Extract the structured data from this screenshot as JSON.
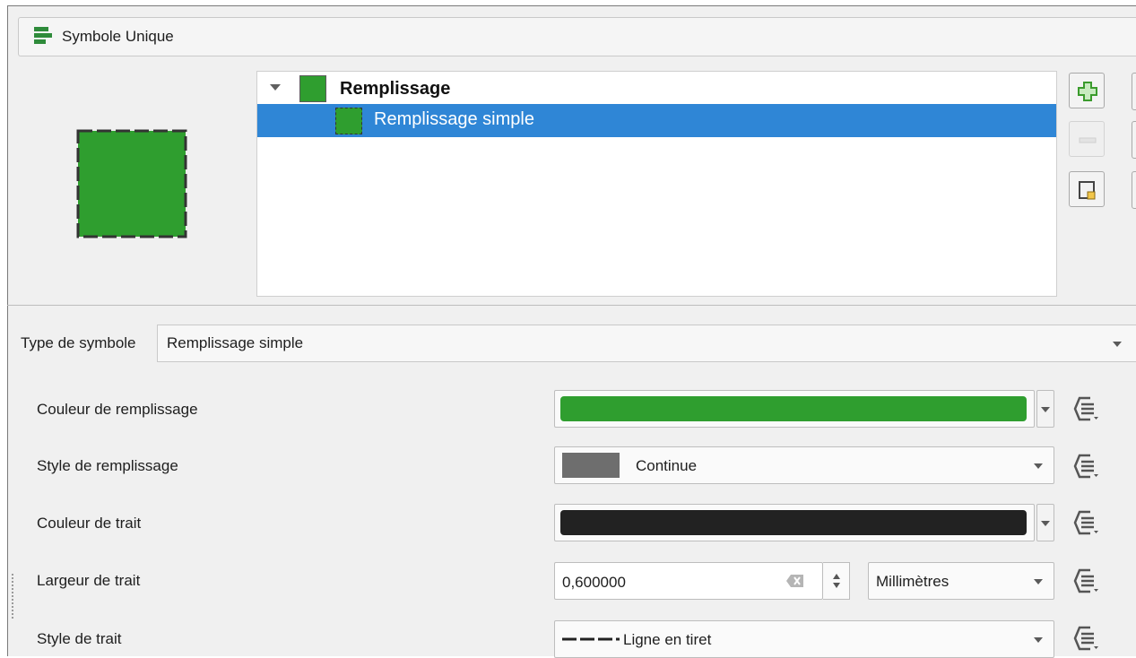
{
  "header": {
    "title": "Symbole Unique",
    "icon": "renderer-icon"
  },
  "tree": {
    "parent_label": "Remplissage",
    "child_label": "Remplissage simple",
    "fill_color": "#2f9e2f",
    "selection_color": "#2f86d6"
  },
  "symbol_type": {
    "label": "Type de symbole",
    "value": "Remplissage simple"
  },
  "properties": {
    "fill_color": {
      "label": "Couleur de remplissage",
      "color": "#2f9e2f"
    },
    "fill_style": {
      "label": "Style de remplissage",
      "value": "Continue"
    },
    "stroke_color": {
      "label": "Couleur de trait",
      "color": "#222222"
    },
    "stroke_width": {
      "label": "Largeur de trait",
      "value": "0,600000",
      "unit": "Millimètres"
    },
    "stroke_style": {
      "label": "Style de trait",
      "value": "Ligne en tiret"
    }
  }
}
